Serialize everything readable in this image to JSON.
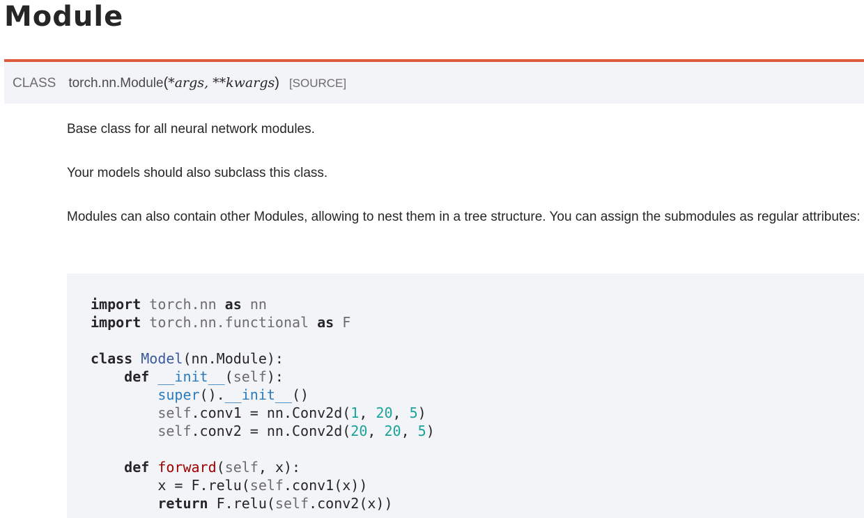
{
  "page": {
    "title": "Module"
  },
  "signature": {
    "kind": "CLASS",
    "name": "torch.nn.Module",
    "open_paren": "(",
    "arg1": "*args",
    "separator": ", ",
    "arg2": "**kwargs",
    "close_paren": ")",
    "source_link": "[SOURCE]"
  },
  "description": {
    "p1": "Base class for all neural network modules.",
    "p2": "Your models should also subclass this class.",
    "p3": "Modules can also contain other Modules, allowing to nest them in a tree structure. You can assign the submodules as regular attributes:"
  },
  "code": {
    "lines": [
      "import torch.nn as nn",
      "import torch.nn.functional as F",
      "",
      "class Model(nn.Module):",
      "    def __init__(self):",
      "        super().__init__()",
      "        self.conv1 = nn.Conv2d(1, 20, 5)",
      "        self.conv2 = nn.Conv2d(20, 20, 5)",
      "",
      "    def forward(self, x):",
      "        x = F.relu(self.conv1(x))",
      "        return F.relu(self.conv2(x))"
    ]
  },
  "colors": {
    "accent_rule": "#e05a3d",
    "signature_bg": "#f3f4f7",
    "code_bg": "#f3f4f7",
    "number": "#1aa39a",
    "function_name": "#a00000",
    "class_name": "#3b5998",
    "builtin": "#2a7bbd"
  }
}
